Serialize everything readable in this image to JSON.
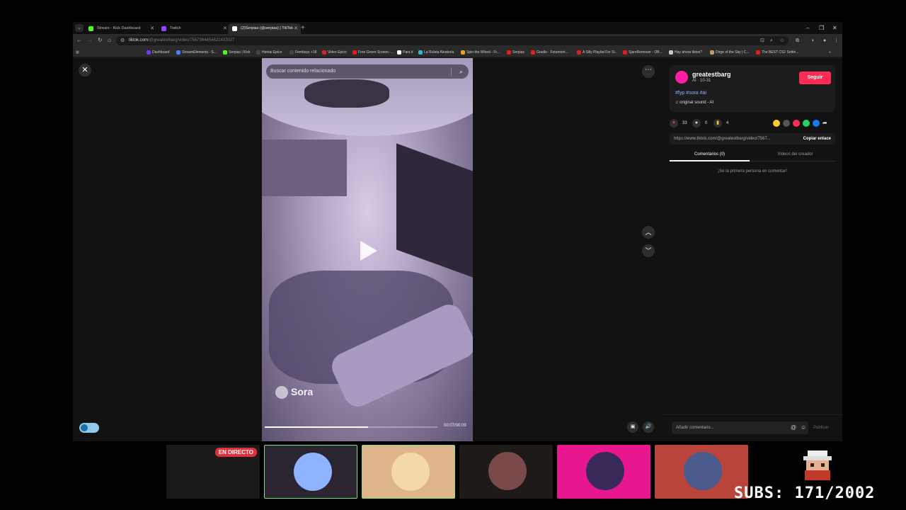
{
  "browser": {
    "tabs": [
      {
        "label": "Stream - Kick Dashboard",
        "color": "#53fc18"
      },
      {
        "label": "Twitch",
        "color": "#9146ff"
      },
      {
        "label": "(2)Serpias (@serpias) | TikTok",
        "color": "#ffffff"
      }
    ],
    "url_host": "tiktok.com",
    "url_path": "/@greatestbarg/video/7567364454822433027",
    "bookmarks": [
      "Dashboard",
      "StreamElements - S...",
      "Serpias | Kick",
      "Hentai Epico",
      "Femboys +18",
      "Video Epico",
      "Free Green Screen -...",
      "Para ti",
      "La Ruleta Aleatoria",
      "Spin the Wheel - Fr...",
      "Serpias",
      "Gradle - Fotomont...",
      "A Silly Playlist For Si...",
      "SjareRemover - OB...",
      "Hay ahora tiktos?",
      "Dirge of the Sky | C...",
      "The BEST CS2 Settin..."
    ]
  },
  "video": {
    "search_placeholder": "Buscar contenido relacionado",
    "watermark": "Sora",
    "timecode": "00:07/00:09",
    "progress": 0.6
  },
  "creator": {
    "name": "greatestbarg",
    "sub": "AI · 10-31",
    "follow_label": "Seguir",
    "tags": "#fyp #sora #ai",
    "sound": "original sound - AI"
  },
  "stats": {
    "likes": "33",
    "comments": "0",
    "saves": "4"
  },
  "link": {
    "url": "https://www.tiktok.com/@greatestbarg/video/7567...",
    "copy_label": "Copiar enlace"
  },
  "tabs": {
    "comments": "Comentarios (0)",
    "creator_videos": "Videos del creador"
  },
  "empty_message": "¡Sé la primera persona en comentar!",
  "comment": {
    "placeholder": "Añadir comentario...",
    "publish": "Publicar"
  },
  "overlay": {
    "live_badge": "EN DIRECTO",
    "subs": "SUBS: 171/2002",
    "slot_colors": [
      "#2a2530",
      "#e0b48a",
      "#1e1a18",
      "#e8178f",
      "#b8443b"
    ]
  }
}
